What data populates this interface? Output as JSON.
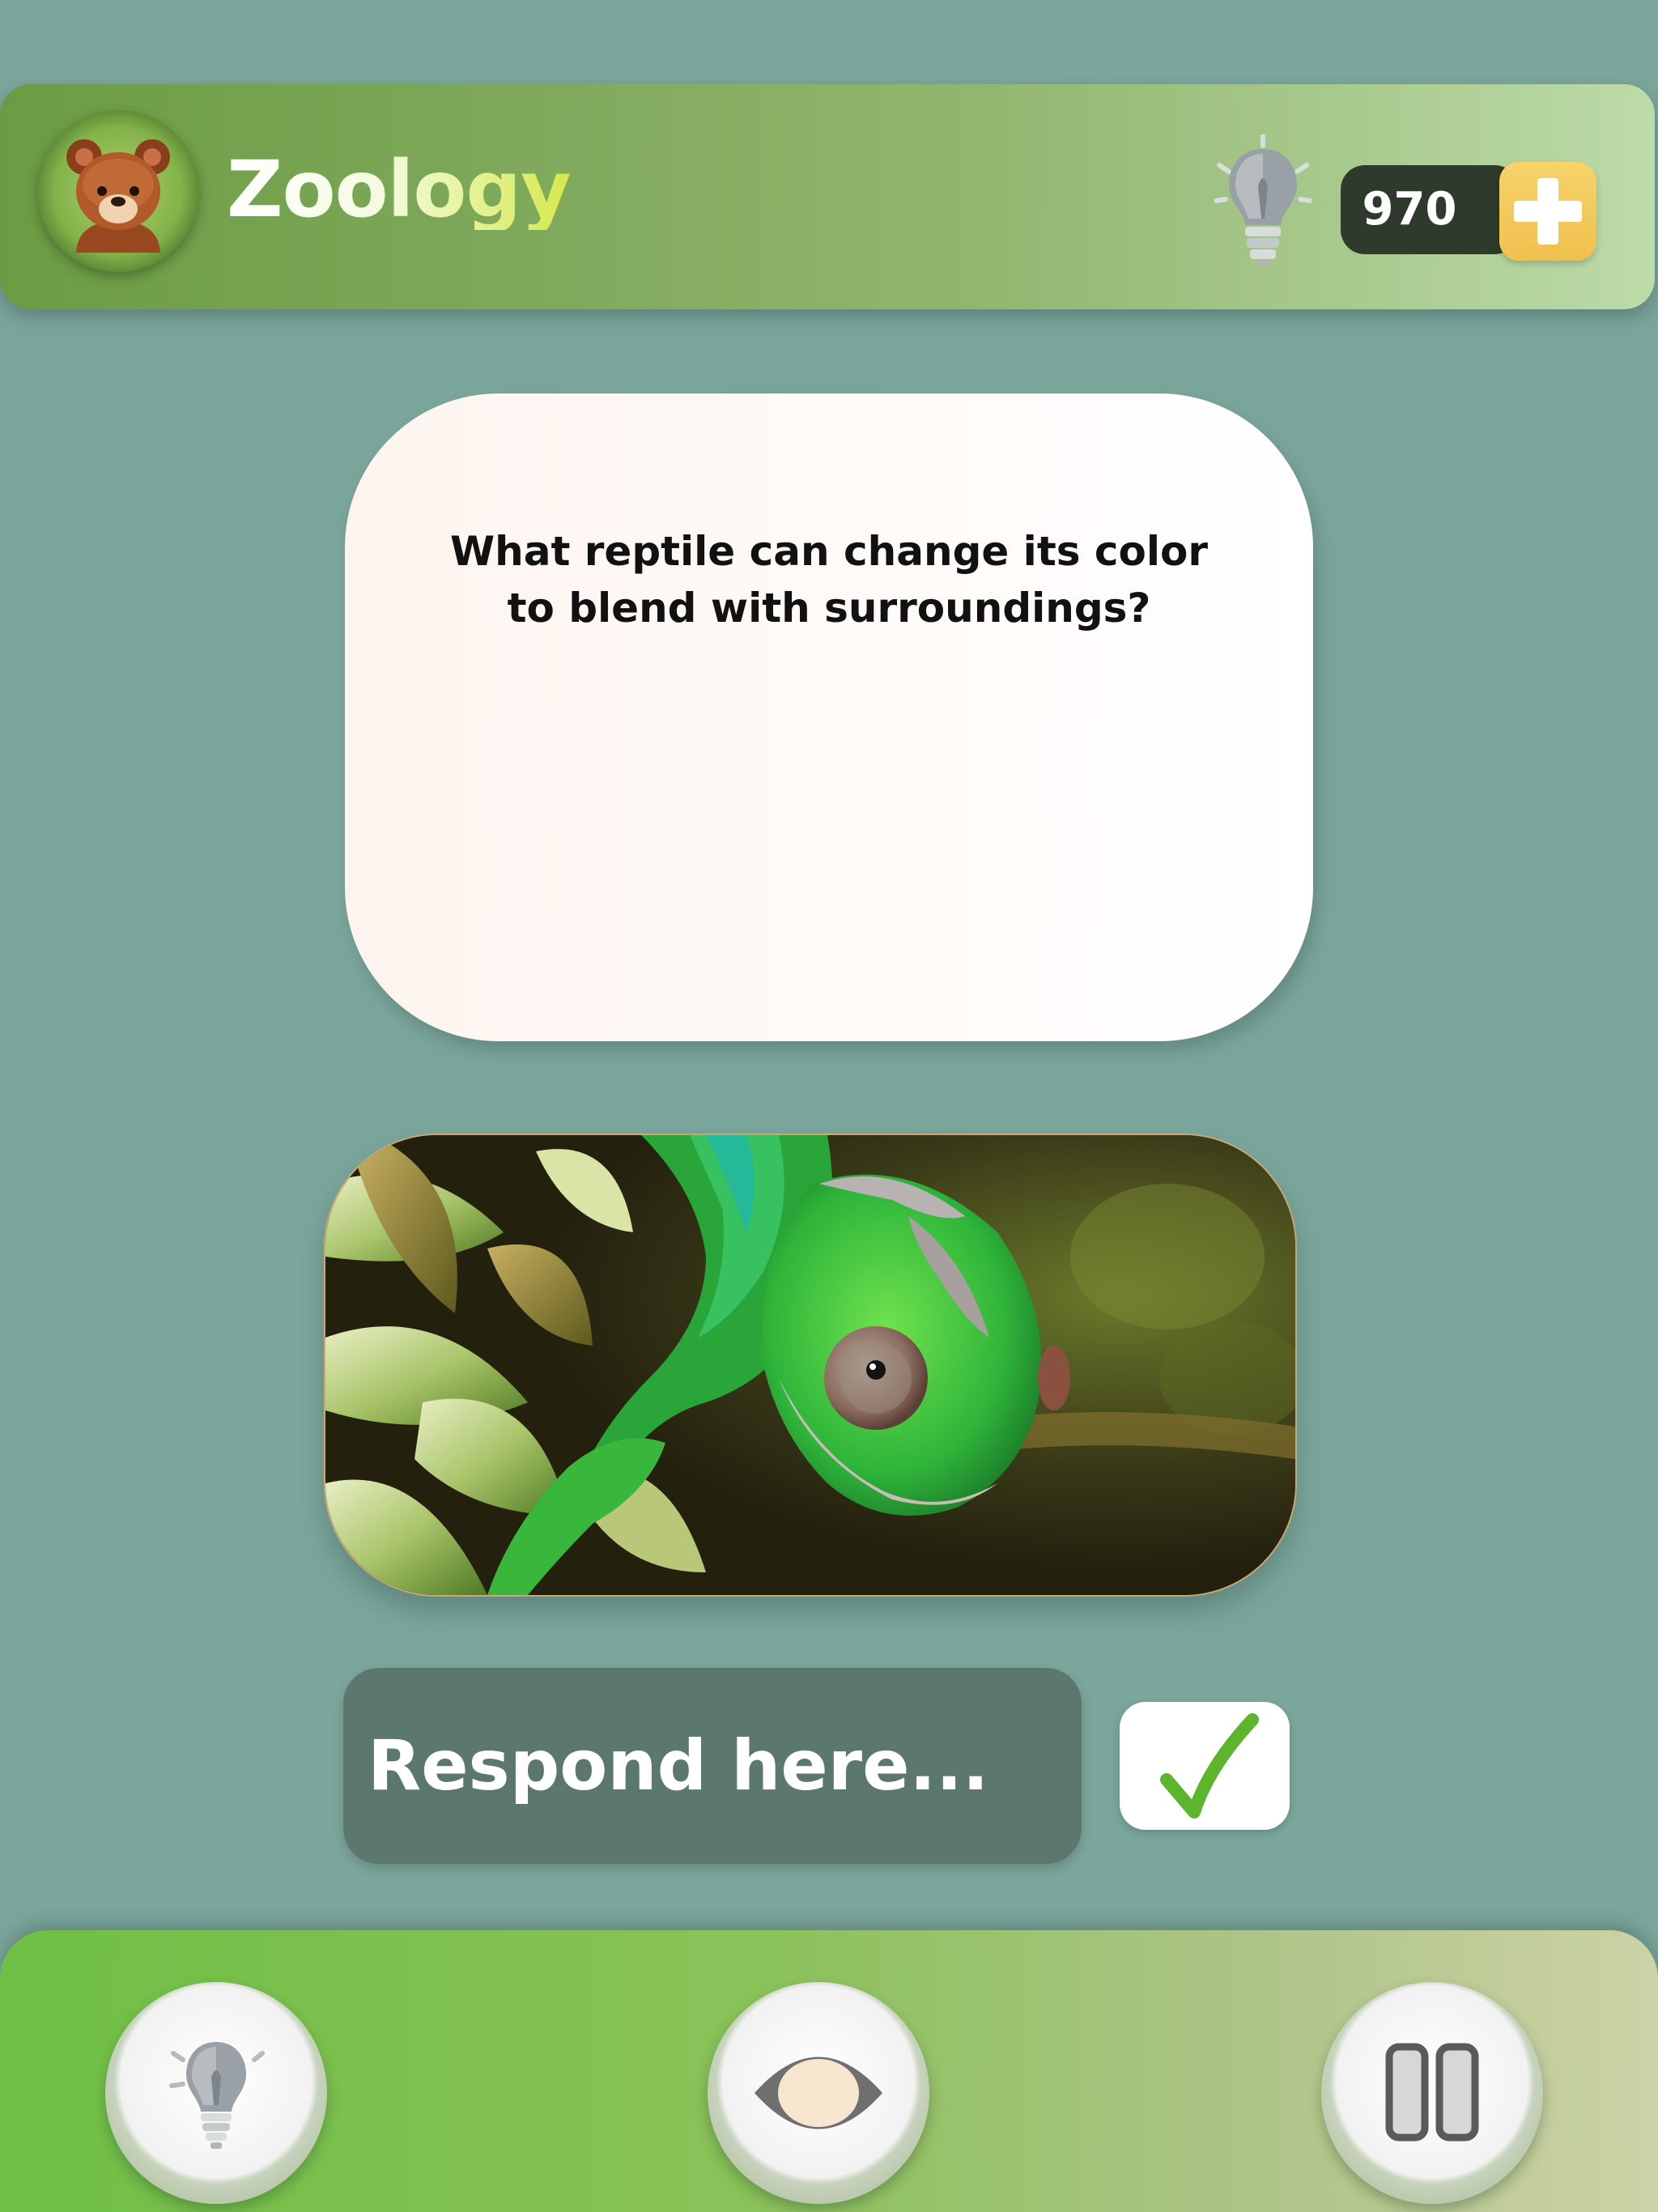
{
  "header": {
    "title": "Zoology",
    "coins": "970",
    "avatar_icon": "bear-face-icon",
    "hint_icon": "lightbulb-icon",
    "add_icon": "plus-icon"
  },
  "question": {
    "text": "What reptile can change its color to blend with surroundings?"
  },
  "picture": {
    "subject": "chameleon-photo"
  },
  "answer": {
    "placeholder": "Respond here...",
    "value": "",
    "submit_icon": "checkmark-icon"
  },
  "bottom_bar": {
    "buttons": [
      {
        "icon": "lightbulb-icon"
      },
      {
        "icon": "eye-icon"
      },
      {
        "icon": "pause-icon"
      }
    ]
  },
  "colors": {
    "background": "#7ba69c",
    "header_gradient_start": "#6b9c43",
    "header_gradient_end": "#bcdba8",
    "accent_yellow": "#f0c04e",
    "coins_pill": "#2e3a2c",
    "input_fill": "#5c786e",
    "check_green": "#5db52e",
    "bottom_gradient_start": "#6fbf45",
    "bottom_gradient_end": "#cdd2a6"
  }
}
